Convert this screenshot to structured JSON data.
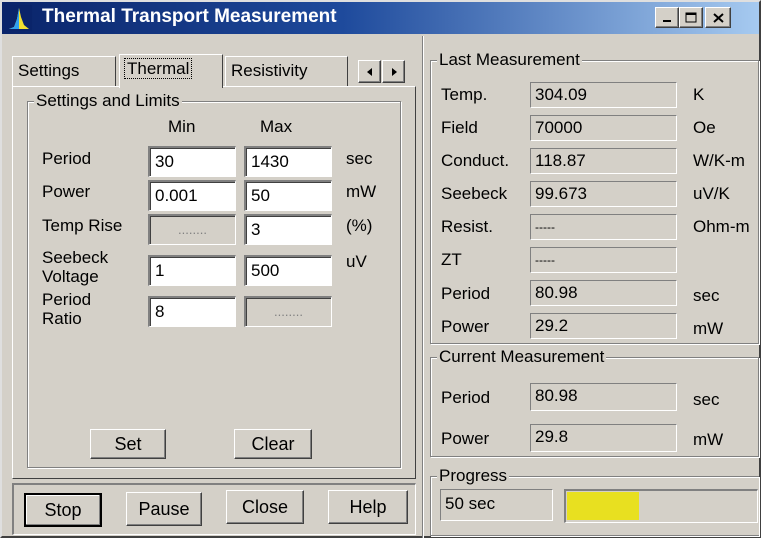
{
  "window": {
    "title": "Thermal Transport Measurement"
  },
  "tabs": {
    "items": [
      "Settings",
      "Thermal",
      "Resistivity"
    ],
    "active": "Thermal"
  },
  "settings_limits": {
    "title": "Settings and Limits",
    "col_min": "Min",
    "col_max": "Max",
    "rows": {
      "period": {
        "label": "Period",
        "min": "30",
        "max": "1430",
        "unit": "sec"
      },
      "power": {
        "label": "Power",
        "min": "0.001",
        "max": "50",
        "unit": "mW"
      },
      "temp_rise": {
        "label": "Temp Rise",
        "min": "........",
        "max": "3",
        "unit": "(%)"
      },
      "seebeck_voltage": {
        "label_line1": "Seebeck",
        "label_line2": "Voltage",
        "min": "1",
        "max": "500",
        "unit": "uV"
      },
      "period_ratio": {
        "label_line1": "Period",
        "label_line2": "Ratio",
        "min": "8",
        "max": "........"
      }
    },
    "set_label": "Set",
    "clear_label": "Clear"
  },
  "bottom_buttons": {
    "stop": "Stop",
    "pause": "Pause",
    "close": "Close",
    "help": "Help"
  },
  "last_measurement": {
    "title": "Last Measurement",
    "rows": {
      "temp": {
        "label": "Temp.",
        "value": "304.09",
        "unit": "K"
      },
      "field": {
        "label": "Field",
        "value": "70000",
        "unit": "Oe"
      },
      "conduct": {
        "label": "Conduct.",
        "value": "118.87",
        "unit": "W/K-m"
      },
      "seebeck": {
        "label": "Seebeck",
        "value": "99.673",
        "unit": "uV/K"
      },
      "resist": {
        "label": "Resist.",
        "value": "-----",
        "unit": "Ohm-m"
      },
      "zt": {
        "label": "ZT",
        "value": "-----",
        "unit": ""
      },
      "period": {
        "label": "Period",
        "value": "80.98",
        "unit": "sec"
      },
      "power": {
        "label": "Power",
        "value": "29.2",
        "unit": "mW"
      }
    }
  },
  "current_measurement": {
    "title": "Current Measurement",
    "rows": {
      "period": {
        "label": "Period",
        "value": "80.98",
        "unit": "sec"
      },
      "power": {
        "label": "Power",
        "value": "29.8",
        "unit": "mW"
      }
    }
  },
  "progress": {
    "title": "Progress",
    "time": "50 sec",
    "fraction": 0.38,
    "bar_color": "#e8e020"
  },
  "colors": {
    "titlebar_start": "#0a246a",
    "titlebar_end": "#a6caf0",
    "face": "#d4d0c8"
  }
}
